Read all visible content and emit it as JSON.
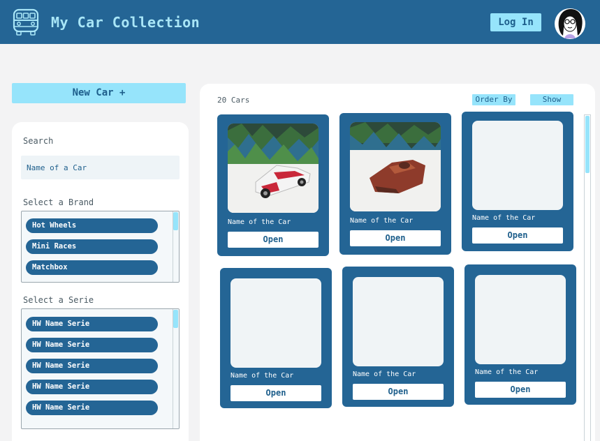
{
  "header": {
    "title": "My Car Collection",
    "logo_icon": "van-icon",
    "login_label": "Log In",
    "avatar_icon": "user-avatar-icon",
    "bg_color": "#246595",
    "accent_color": "#96e4fb"
  },
  "sidebar": {
    "new_car_label": "New Car +",
    "search_label": "Search",
    "search_placeholder": "Name of a Car",
    "brand_label": "Select a Brand",
    "brands": [
      "Hot Wheels",
      "Mini Races",
      "Matchbox"
    ],
    "serie_label": "Select a Serie",
    "series": [
      "HW Name Serie",
      "HW Name Serie",
      "HW Name Serie",
      "HW Name Serie",
      "HW Name Serie"
    ]
  },
  "main": {
    "count_label": "20 Cars",
    "order_by_label": "Order By",
    "show_label": "Show",
    "cards": [
      {
        "name": "Name of the Car",
        "open_label": "Open",
        "image": "white-red-race-car-photo"
      },
      {
        "name": "Name of the Car",
        "open_label": "Open",
        "image": "red-landspeeder-car-photo"
      },
      {
        "name": "Name of the Car",
        "open_label": "Open",
        "image": ""
      },
      {
        "name": "Name of the Car",
        "open_label": "Open",
        "image": ""
      },
      {
        "name": "Name of the Car",
        "open_label": "Open",
        "image": ""
      },
      {
        "name": "Name of the Car",
        "open_label": "Open",
        "image": ""
      }
    ]
  }
}
